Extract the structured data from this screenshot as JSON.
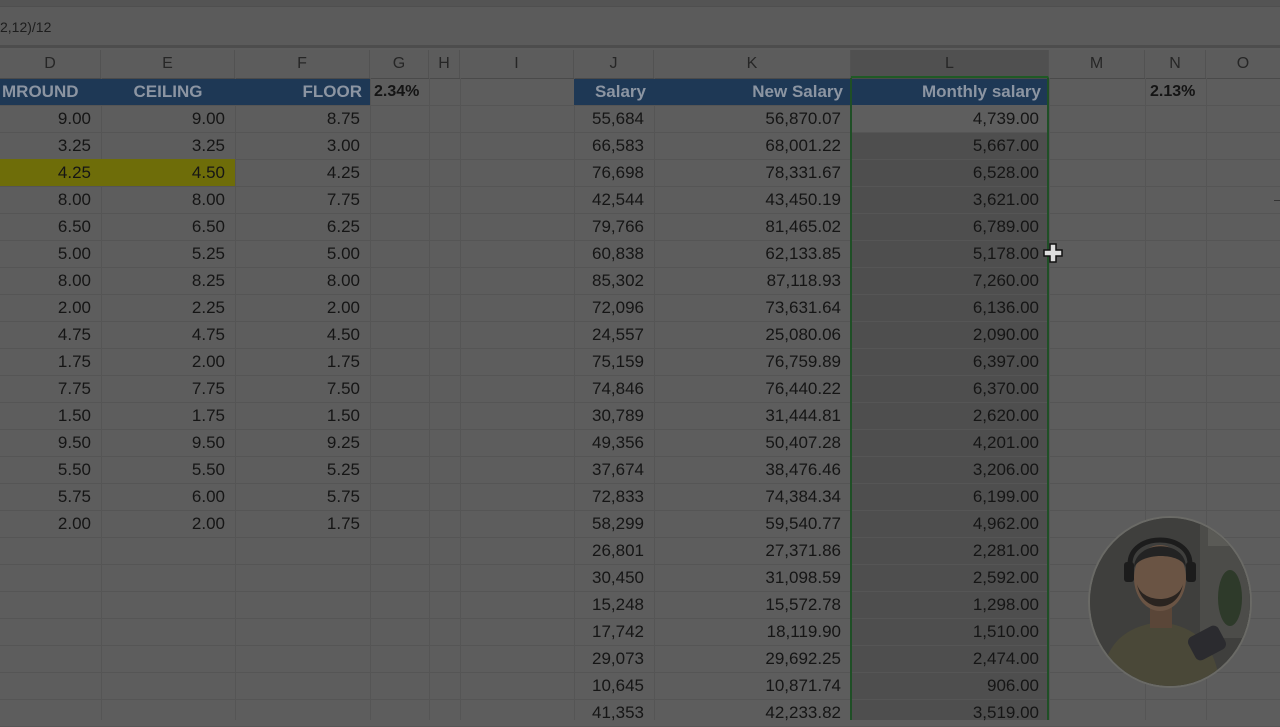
{
  "formula_bar": {
    "text": "2,12)/12"
  },
  "column_headers": [
    "D",
    "E",
    "F",
    "G",
    "H",
    "I",
    "J",
    "K",
    "L",
    "M",
    "N",
    "O"
  ],
  "table_left": {
    "headers": {
      "d": "MROUND",
      "e": "CEILING",
      "f": "FLOOR"
    },
    "rate": "2.34%",
    "rows": [
      [
        "9.00",
        "9.00",
        "8.75"
      ],
      [
        "3.25",
        "3.25",
        "3.00"
      ],
      [
        "4.25",
        "4.50",
        "4.25"
      ],
      [
        "8.00",
        "8.00",
        "7.75"
      ],
      [
        "6.50",
        "6.50",
        "6.25"
      ],
      [
        "5.00",
        "5.25",
        "5.00"
      ],
      [
        "8.00",
        "8.25",
        "8.00"
      ],
      [
        "2.00",
        "2.25",
        "2.00"
      ],
      [
        "4.75",
        "4.75",
        "4.50"
      ],
      [
        "1.75",
        "2.00",
        "1.75"
      ],
      [
        "7.75",
        "7.75",
        "7.50"
      ],
      [
        "1.50",
        "1.75",
        "1.50"
      ],
      [
        "9.50",
        "9.50",
        "9.25"
      ],
      [
        "5.50",
        "5.50",
        "5.25"
      ],
      [
        "5.75",
        "6.00",
        "5.75"
      ],
      [
        "2.00",
        "2.00",
        "1.75"
      ]
    ],
    "highlight_color": "#6e6d09"
  },
  "table_right": {
    "headers": {
      "j": "Salary",
      "k": "New Salary",
      "l": "Monthly salary"
    },
    "rate": "2.13%",
    "rows": [
      [
        "55,684",
        "56,870.07",
        "4,739.00"
      ],
      [
        "66,583",
        "68,001.22",
        "5,667.00"
      ],
      [
        "76,698",
        "78,331.67",
        "6,528.00"
      ],
      [
        "42,544",
        "43,450.19",
        "3,621.00"
      ],
      [
        "79,766",
        "81,465.02",
        "6,789.00"
      ],
      [
        "60,838",
        "62,133.85",
        "5,178.00"
      ],
      [
        "85,302",
        "87,118.93",
        "7,260.00"
      ],
      [
        "72,096",
        "73,631.64",
        "6,136.00"
      ],
      [
        "24,557",
        "25,080.06",
        "2,090.00"
      ],
      [
        "75,159",
        "76,759.89",
        "6,397.00"
      ],
      [
        "74,846",
        "76,440.22",
        "6,370.00"
      ],
      [
        "30,789",
        "31,444.81",
        "2,620.00"
      ],
      [
        "49,356",
        "50,407.28",
        "4,201.00"
      ],
      [
        "37,674",
        "38,476.46",
        "3,206.00"
      ],
      [
        "72,833",
        "74,384.34",
        "6,199.00"
      ],
      [
        "58,299",
        "59,540.77",
        "4,962.00"
      ],
      [
        "26,801",
        "27,371.86",
        "2,281.00"
      ],
      [
        "30,450",
        "31,098.59",
        "2,592.00"
      ],
      [
        "15,248",
        "15,572.78",
        "1,298.00"
      ],
      [
        "17,742",
        "18,119.90",
        "1,510.00"
      ],
      [
        "29,073",
        "29,692.25",
        "2,474.00"
      ],
      [
        "10,645",
        "10,871.74",
        "906.00"
      ],
      [
        "41,353",
        "42,233.82",
        "3,519.00"
      ]
    ]
  },
  "colors": {
    "header_fill": "#1e3855",
    "selection_border": "#1f4f26"
  },
  "icons": {
    "cursor": "cell-select-plus-cursor-icon",
    "webcam": "presenter-webcam"
  }
}
